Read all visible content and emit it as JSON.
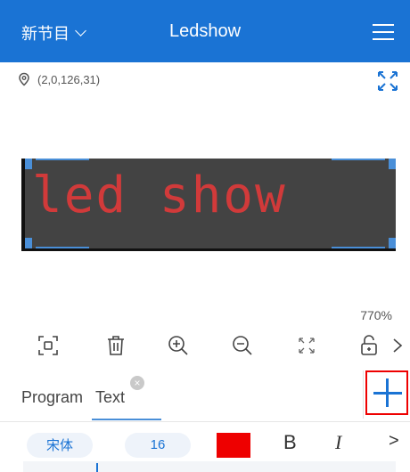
{
  "header": {
    "program_selector": "新节目",
    "title": "Ledshow"
  },
  "canvas": {
    "position_readout": "(2,0,126,31)",
    "led_text": "led show",
    "led_color": "#d13a3a",
    "background_color": "#434343",
    "zoom": "770%"
  },
  "toolbar": {
    "icons": [
      "fit-screen-icon",
      "delete-icon",
      "zoom-in-icon",
      "zoom-out-icon",
      "fullscreen-icon",
      "unlock-icon",
      "chevron-right-icon"
    ]
  },
  "tabs": {
    "items": [
      {
        "label": "Program"
      },
      {
        "label": "Text"
      }
    ],
    "close_label": "×"
  },
  "format": {
    "font_name": "宋体",
    "font_size": "16",
    "color": "#ee0000",
    "bold_label": "B",
    "italic_label": "I",
    "more_label": ">"
  },
  "colors": {
    "brand": "#1a73d4",
    "highlight": "#e00000"
  }
}
